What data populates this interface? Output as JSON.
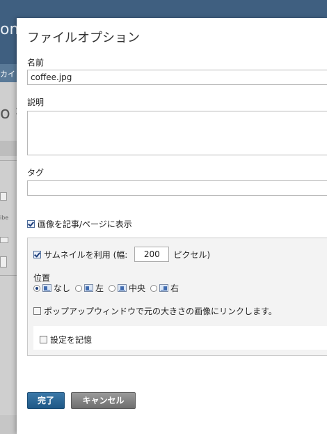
{
  "background": {
    "header_fragment": "om",
    "nav_fragment": "カイ",
    "body_fragment": "o 投",
    "small_fragment": "ibe"
  },
  "dialog": {
    "title": "ファイルオプション",
    "name_label": "名前",
    "name_value": "coffee.jpg",
    "description_label": "説明",
    "description_value": "",
    "tags_label": "タグ",
    "tags_value": "",
    "show_in_post_label": "画像を記事/ページに表示",
    "show_in_post_checked": true,
    "thumbnail": {
      "label": "サムネイルを利用 (幅:",
      "checked": true,
      "width_value": "200",
      "unit_label": "ピクセル)"
    },
    "position": {
      "label": "位置",
      "options": [
        {
          "label": "なし",
          "selected": true,
          "icon": "align-none-icon"
        },
        {
          "label": "左",
          "selected": false,
          "icon": "align-left-icon"
        },
        {
          "label": "中央",
          "selected": false,
          "icon": "align-center-icon"
        },
        {
          "label": "右",
          "selected": false,
          "icon": "align-right-icon"
        }
      ]
    },
    "popup_link_label": "ポップアップウィンドウで元の大きさの画像にリンクします。",
    "popup_link_checked": false,
    "remember_label": "設定を記憶",
    "remember_checked": false,
    "done_button": "完了",
    "cancel_button": "キャンセル"
  },
  "colors": {
    "header_bg": "#3f5f80",
    "done_button": "#1f5886",
    "cancel_button": "#6e6e6e"
  }
}
